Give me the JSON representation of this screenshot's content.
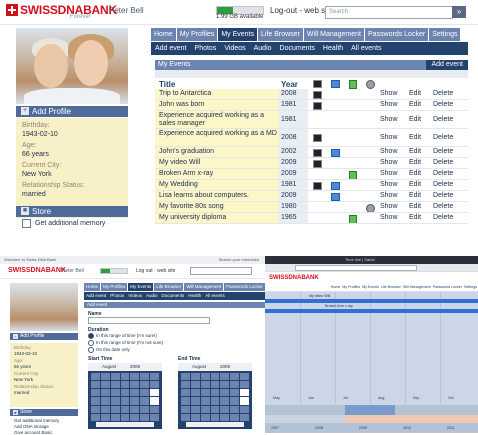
{
  "app": {
    "brand": "SWISSDNABANK",
    "brand_sub": "Forever",
    "user": "Peter Bell",
    "storage_text": "1.99 GB available",
    "storage_fraction": 0.35,
    "logout": "Log-out - web site",
    "search_placeholder": "Search",
    "search_button": "»"
  },
  "sidebar": {
    "add_profile": "Add Profile",
    "birthday_label": "Birthday:",
    "birthday": "1943-02-10",
    "age_label": "Age:",
    "age": "66 years",
    "city_label": "Current City:",
    "city": "New York",
    "rel_label": "Relationship Status:",
    "rel": "married",
    "store": "Store",
    "store_item": "Get additional memory"
  },
  "nav": {
    "tabs": [
      "Home",
      "My Profiles",
      "My Events",
      "Life Browser",
      "Will Management",
      "Passwords Locker",
      "Settings"
    ],
    "active_tab": 2,
    "subtabs": [
      "Add event",
      "Photos",
      "Videos",
      "Audio",
      "Documents",
      "Health",
      "All events"
    ]
  },
  "events": {
    "panel_title": "My Events",
    "add_button": "Add event",
    "col_title": "Title",
    "col_year": "Year",
    "action_show": "Show",
    "action_edit": "Edit",
    "action_delete": "Delete",
    "rows": [
      {
        "title": "Trip to Antarctica",
        "year": "2008",
        "icons": [
          "film"
        ]
      },
      {
        "title": "John was born",
        "year": "1981",
        "icons": [
          "film"
        ]
      },
      {
        "title": "Experience acquired working as a sales manager",
        "year": "1981",
        "icons": []
      },
      {
        "title": "Experience acquired working as a MD",
        "year": "2008",
        "icons": [
          "film"
        ]
      },
      {
        "title": "John's graduation",
        "year": "2002",
        "icons": [
          "film",
          "photo"
        ]
      },
      {
        "title": "My video Will",
        "year": "2009",
        "icons": [
          "film"
        ]
      },
      {
        "title": "Broken Arm x-ray",
        "year": "2009",
        "icons": [
          "doc"
        ]
      },
      {
        "title": "My Wedding",
        "year": "1981",
        "icons": [
          "film",
          "photo"
        ]
      },
      {
        "title": "Lisa learns about computers.",
        "year": "2009",
        "icons": [
          "photo"
        ]
      },
      {
        "title": "My favorite 80s song",
        "year": "1980",
        "icons": [
          "audio"
        ]
      },
      {
        "title": "My university diploma",
        "year": "1965",
        "icons": [
          "doc"
        ]
      }
    ]
  },
  "bottom_left": {
    "window_title": "Welcome to Swiss DNA Bank",
    "window_right": "Search your memories",
    "user": "Peter Bell",
    "logout": "Log out · web site",
    "add_event": "Add event",
    "name_label": "Name",
    "duration_label": "Duration",
    "radio1": "In this range of time (I'm sure!)",
    "radio2": "In this range of time (I'm not sure)",
    "radio3": "On this date only",
    "start_label": "Start Time",
    "end_label": "End Time",
    "start_month": "August",
    "start_year": "2009",
    "end_month": "August",
    "end_year": "2009",
    "store_items": [
      "Get additional memory",
      "Add DNA storage",
      "Give account Basic"
    ]
  },
  "bottom_right": {
    "window_title": "Time line | Safari",
    "tabs": [
      "Home",
      "My Profiles",
      "My Events",
      "Life Browser",
      "Will Management",
      "Passwords Locker",
      "Settings"
    ],
    "events": [
      "My video Will",
      "Broken Arm x-ray"
    ],
    "months": [
      "May",
      "Jun",
      "Jul",
      "Aug",
      "Sep",
      "Oct"
    ],
    "years": [
      "2007",
      "2008",
      "2009",
      "2010",
      "2011"
    ]
  }
}
